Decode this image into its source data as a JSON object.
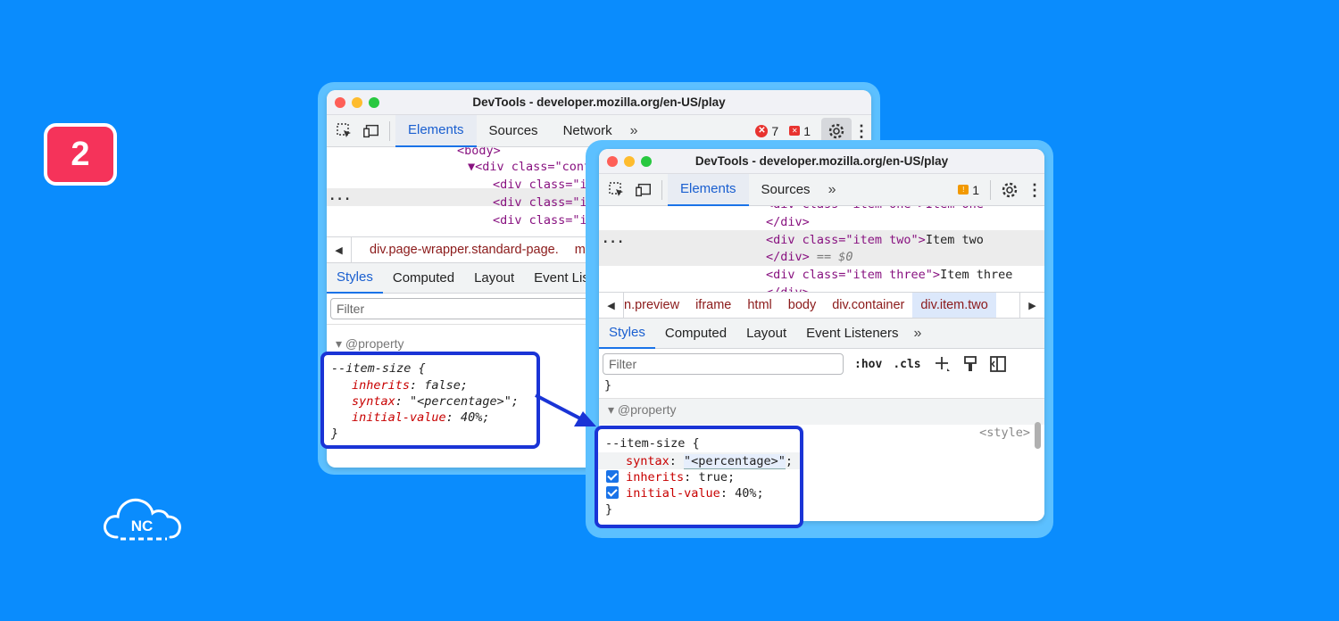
{
  "badge": {
    "number": "2"
  },
  "logo": {
    "text": "NC"
  },
  "colors": {
    "background": "#0a8cfd",
    "accent": "#1a73e8",
    "badge": "#f5335a",
    "callout_border": "#1a34d6"
  },
  "back_window": {
    "title": "DevTools - developer.mozilla.org/en-US/play",
    "tabs": [
      "Elements",
      "Sources",
      "Network"
    ],
    "more_tabs": "»",
    "error_count": "7",
    "warning_count": "1",
    "dom_lines": {
      "body": "<body>",
      "div_container": "▼<div class=\"cont",
      "div1": "<div class=\"it",
      "div2": "<div class=\"it",
      "div3": "<div class=\"it"
    },
    "ellipsis": "...",
    "breadcrumbs": [
      "div.page-wrapper.standard-page.",
      "m"
    ],
    "subtabs": [
      "Styles",
      "Computed",
      "Layout",
      "Event Lis"
    ],
    "filter_placeholder": "Filter",
    "at_property": "@property",
    "rule": {
      "selector": "--item-size {",
      "decl1_name": "inherits",
      "decl1_value": "false;",
      "decl2_name": "syntax",
      "decl2_value": "\"<percentage>\";",
      "decl3_name": "initial-value",
      "decl3_value": "40%;",
      "close": "}"
    }
  },
  "front_window": {
    "title": "DevTools - developer.mozilla.org/en-US/play",
    "tabs": [
      "Elements",
      "Sources"
    ],
    "more_tabs": "»",
    "warning_count": "1",
    "dom": {
      "line0": "<div class=\"item one\">Item one",
      "line1": "</div>",
      "line2_tag": "<div class=\"item two\">",
      "line2_text": "Item two",
      "line3": "</div>",
      "line3_marker": "== $0",
      "line4_tag": "<div class=\"item three\">",
      "line4_text": "Item three",
      "line5": "</div>"
    },
    "ellipsis": "...",
    "breadcrumbs": [
      "n.preview",
      "iframe",
      "html",
      "body",
      "div.container",
      "div.item.two"
    ],
    "subtabs": [
      "Styles",
      "Computed",
      "Layout",
      "Event Listeners"
    ],
    "subtabs_more": "»",
    "filter_placeholder": "Filter",
    "hov": ":hov",
    "cls": ".cls",
    "close_brace": "}",
    "at_property": "@property",
    "rule": {
      "selector": "--item-size {",
      "source": "<style>",
      "decl1_name": "syntax",
      "decl1_value": "\"<percentage>\"",
      "decl2_name": "inherits",
      "decl2_value": "true;",
      "decl3_name": "initial-value",
      "decl3_value": "40%;",
      "close": "}"
    }
  }
}
